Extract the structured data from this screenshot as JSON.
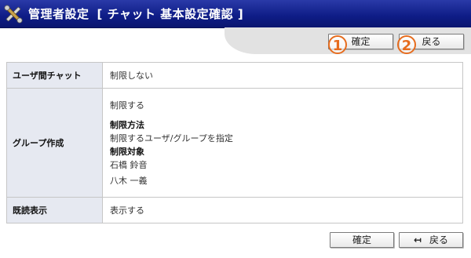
{
  "header": {
    "title": "管理者設定",
    "subtitle": "[ チャット 基本設定確認 ]",
    "icon": "tools-icon"
  },
  "toolbar": {
    "confirm_label": "確定",
    "back_label": "戻る",
    "markers": [
      "1",
      "2"
    ]
  },
  "settings": {
    "user_chat": {
      "label": "ユーザ間チャット",
      "value": "制限しない"
    },
    "group_create": {
      "label": "グループ作成",
      "value": "制限する",
      "method_heading": "制限方法",
      "method_value": "制限するユーザ/グループを指定",
      "target_heading": "制限対象",
      "targets": [
        "石橋 鈴音",
        "八木 一義"
      ]
    },
    "read_display": {
      "label": "既読表示",
      "value": "表示する"
    }
  },
  "footer": {
    "confirm_label": "確定",
    "back_label": "戻る"
  },
  "colors": {
    "header": "#0e1c86",
    "marker": "#e66c1e",
    "label_bg": "#e6e9f1"
  }
}
